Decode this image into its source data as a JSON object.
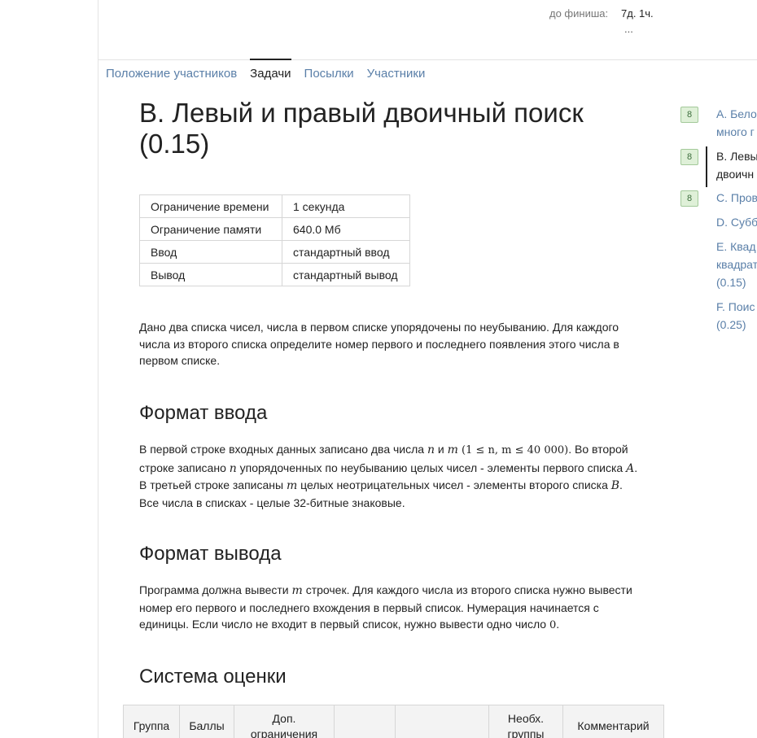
{
  "timer": {
    "label": "до финиша:",
    "value": "7д. 1ч.",
    "more": "..."
  },
  "tabs": [
    {
      "label": "Положение участников",
      "active": false
    },
    {
      "label": "Задачи",
      "active": true
    },
    {
      "label": "Посылки",
      "active": false
    },
    {
      "label": "Участники",
      "active": false
    }
  ],
  "problem": {
    "title": "B. Левый и правый двоичный поиск (0.15)",
    "limits": [
      {
        "name": "Ограничение времени",
        "value": "1 секунда"
      },
      {
        "name": "Ограничение памяти",
        "value": "640.0 Мб"
      },
      {
        "name": "Ввод",
        "value": "стандартный ввод"
      },
      {
        "name": "Вывод",
        "value": "стандартный вывод"
      }
    ],
    "statement": "Дано два списка чисел, числа в первом списке упорядочены по неубыванию. Для каждого числа из второго списка определите номер первого и последнего появления этого числа в первом списке.",
    "input_heading": "Формат ввода",
    "input_parts": {
      "p1": "В первой строке входных данных записано два числа ",
      "m_n": "n",
      "p2": " и ",
      "m_m": "m",
      "m_range": " (1 ≤ n, m ≤ 40 000)",
      "p3": ". Во второй строке записано ",
      "m_n2": "n",
      "p4": " упорядоченных по неубыванию целых чисел - элементы первого списка ",
      "m_A": "A",
      "p5": ". В третьей строке записаны ",
      "m_m2": "m",
      "p6": " целых неотрицательных чисел - элементы второго списка ",
      "m_B": "B",
      "p7": ". Все числа в списках - целые 32-битные знаковые."
    },
    "output_heading": "Формат вывода",
    "output_parts": {
      "p1": "Программа должна вывести ",
      "m_m": "m",
      "p2": " строчек. Для каждого числа из второго списка нужно вывести номер его первого и последнего вхождения в первый список. Нумерация начинается с единицы. Если число не входит в первый список, нужно вывести одно число ",
      "m_0": "0",
      "p3": "."
    },
    "scoring_heading": "Система оценки",
    "scoring_columns": [
      "Группа",
      "Баллы",
      "Доп. ограничения",
      "",
      "",
      "Необх. группы",
      "Комментарий"
    ]
  },
  "sidebar": {
    "items": [
      {
        "badge": "8",
        "line1": "A. Бело",
        "line2": "много г",
        "active": false
      },
      {
        "badge": "8",
        "line1": "B. Левы",
        "line2": "двоичн",
        "active": true
      },
      {
        "badge": "8",
        "line1": "C. Пров",
        "line2": "",
        "active": false
      },
      {
        "badge": "",
        "line1": "D. Субб",
        "line2": "",
        "active": false
      },
      {
        "badge": "",
        "line1": "E. Квад",
        "line2": "квадрат",
        "line3": "(0.15)",
        "active": false
      },
      {
        "badge": "",
        "line1": "F. Поис",
        "line2": "(0.25)",
        "active": false
      }
    ]
  }
}
